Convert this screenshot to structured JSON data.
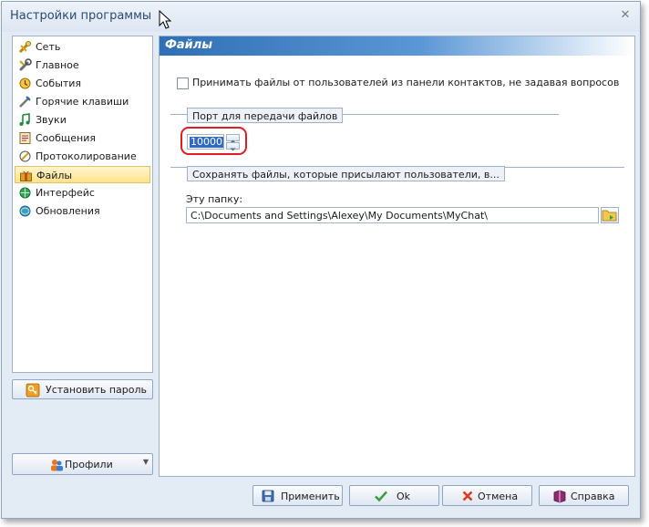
{
  "window": {
    "title": "Настройки программы"
  },
  "nav": {
    "items": [
      {
        "label": "Сеть",
        "icon": "network-icon"
      },
      {
        "label": "Главное",
        "icon": "wrench-icon"
      },
      {
        "label": "События",
        "icon": "events-icon"
      },
      {
        "label": "Горячие клавиши",
        "icon": "hotkeys-icon"
      },
      {
        "label": "Звуки",
        "icon": "music-note-icon"
      },
      {
        "label": "Сообщения",
        "icon": "messages-icon"
      },
      {
        "label": "Протоколирование",
        "icon": "logging-icon"
      },
      {
        "label": "Файлы",
        "icon": "gift-icon",
        "selected": true
      },
      {
        "label": "Интерфейс",
        "icon": "interface-icon"
      },
      {
        "label": "Обновления",
        "icon": "updates-icon"
      }
    ]
  },
  "set_password_button": {
    "label": "Установить пароль"
  },
  "profiles_button": {
    "label": "Профили"
  },
  "panel": {
    "title": "Файлы",
    "accept_checkbox": {
      "label": "Принимать файлы от пользователей из панели контактов, не задавая вопросов",
      "checked": false
    },
    "port_group": {
      "title": "Порт для передачи файлов",
      "value": "10000"
    },
    "save_group": {
      "title": "Сохранять файлы, которые присылают пользователи, в...",
      "folder_label": "Эту папку:",
      "folder_path": "C:\\Documents and Settings\\Alexey\\My Documents\\MyChat\\"
    }
  },
  "footer": {
    "apply": "Применить",
    "ok": "Ok",
    "cancel": "Отмена",
    "help": "Справка"
  },
  "colors": {
    "accent": "#2f6fb5",
    "selected_item": "#ffe28c",
    "highlight_ring": "#e11d24"
  }
}
